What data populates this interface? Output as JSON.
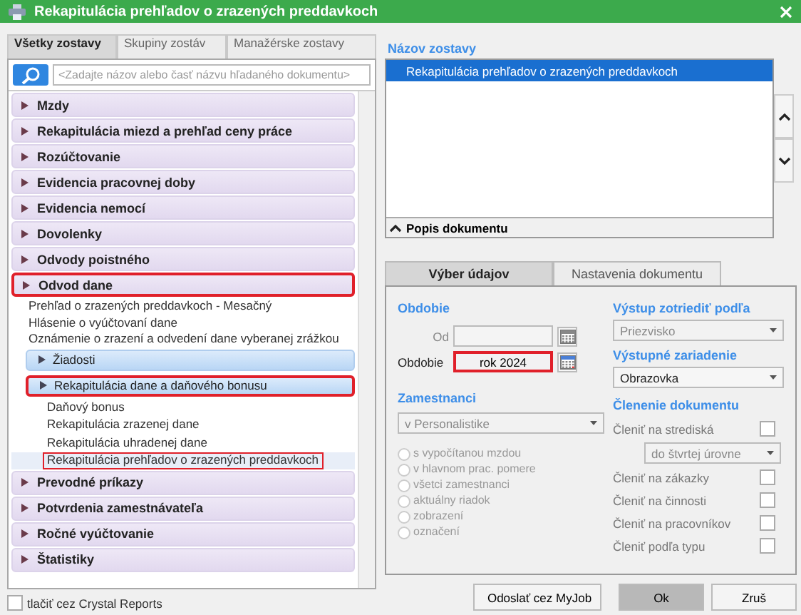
{
  "window": {
    "title": "Rekapitulácia prehľadov o zrazených preddavkoch"
  },
  "left_tabs": [
    {
      "label": "Všetky zostavy",
      "selected": true
    },
    {
      "label": "Skupiny zostáv",
      "selected": false
    },
    {
      "label": "Manažérske zostavy",
      "selected": false
    }
  ],
  "search": {
    "placeholder": "<Zadajte názov alebo časť názvu hľadaného dokumentu>"
  },
  "groups": [
    {
      "label": "Mzdy",
      "highlighted": false
    },
    {
      "label": "Rekapitulácia miezd a prehľad ceny práce",
      "highlighted": false
    },
    {
      "label": "Rozúčtovanie",
      "highlighted": false
    },
    {
      "label": "Evidencia pracovnej doby",
      "highlighted": false
    },
    {
      "label": "Evidencia nemocí",
      "highlighted": false
    },
    {
      "label": "Dovolenky",
      "highlighted": false
    },
    {
      "label": "Odvody poistného",
      "highlighted": false
    },
    {
      "label": "Odvod dane",
      "highlighted": true,
      "children": [
        {
          "kind": "item",
          "label": "Prehľad o zrazených  preddavkoch - Mesačný"
        },
        {
          "kind": "item",
          "label": "Hlásenie o vyúčtovaní dane"
        },
        {
          "kind": "item",
          "label": "Oznámenie o zrazení a odvedení dane vyberanej zrážkou"
        },
        {
          "kind": "subgroup",
          "label": "Žiadosti",
          "highlighted": false
        },
        {
          "kind": "subgroup",
          "label": "Rekapitulácia dane a daňového bonusu",
          "highlighted": true,
          "children": [
            {
              "label": "Daňový bonus",
              "selected": false,
              "highlighted": false
            },
            {
              "label": "Rekapitulácia zrazenej dane",
              "selected": false,
              "highlighted": false
            },
            {
              "label": "Rekapitulácia uhradenej dane",
              "selected": false,
              "highlighted": false
            },
            {
              "label": "Rekapitulácia prehľadov o zrazených preddavkoch",
              "selected": true,
              "highlighted": true
            }
          ]
        }
      ]
    },
    {
      "label": "Prevodné príkazy",
      "highlighted": false
    },
    {
      "label": "Potvrdenia zamestnávateľa",
      "highlighted": false
    },
    {
      "label": "Ročné vyúčtovanie",
      "highlighted": false
    },
    {
      "label": "Štatistiky",
      "highlighted": false
    }
  ],
  "crystal": {
    "label": "tlačiť cez Crystal Reports",
    "checked": false
  },
  "report_list": {
    "heading": "Názov zostavy",
    "items": [
      {
        "label": "Rekapitulácia prehľadov o zrazených preddavkoch",
        "selected": true
      }
    ],
    "description": "Popis dokumentu"
  },
  "form_tabs": [
    {
      "label": "Výber údajov",
      "selected": true
    },
    {
      "label": "Nastavenia dokumentu",
      "selected": false
    }
  ],
  "period": {
    "heading": "Obdobie",
    "from_label": "Od",
    "period_label": "Obdobie",
    "period_value": "rok 2024",
    "highlighted": true
  },
  "employees": {
    "heading": "Zamestnanci",
    "select": "v Personalistike",
    "options": [
      {
        "label": "s vypočítanou mzdou",
        "selected": false
      },
      {
        "label": "v hlavnom prac. pomere",
        "selected": false
      },
      {
        "label": "všetci zamestnanci",
        "selected": false
      },
      {
        "label": "aktuálny riadok",
        "selected": false
      },
      {
        "label": "zobrazení",
        "selected": false
      },
      {
        "label": "označení",
        "selected": false
      }
    ],
    "disabled": true
  },
  "sort": {
    "heading": "Výstup zotriediť podľa",
    "value": "Priezvisko",
    "disabled": true
  },
  "output": {
    "heading": "Výstupné zariadenie",
    "value": "Obrazovka",
    "disabled": false
  },
  "breakdown": {
    "heading": "Členenie dokumentu",
    "rows": [
      {
        "kind": "checkbox",
        "label": "Členiť na strediská",
        "checked": false
      },
      {
        "kind": "select",
        "value": "do štvrtej úrovne"
      },
      {
        "kind": "checkbox",
        "label": "Členiť na zákazky",
        "checked": false
      },
      {
        "kind": "checkbox",
        "label": "Členiť na činnosti",
        "checked": false
      },
      {
        "kind": "checkbox",
        "label": "Členiť na pracovníkov",
        "checked": false
      },
      {
        "kind": "checkbox",
        "label": "Členiť podľa typu",
        "checked": false
      }
    ]
  },
  "buttons": [
    {
      "kind": "myjob",
      "label": "Odoslať cez MyJob"
    },
    {
      "kind": "default",
      "label": "Ok"
    },
    {
      "kind": "plain",
      "label": "Zruš"
    }
  ]
}
